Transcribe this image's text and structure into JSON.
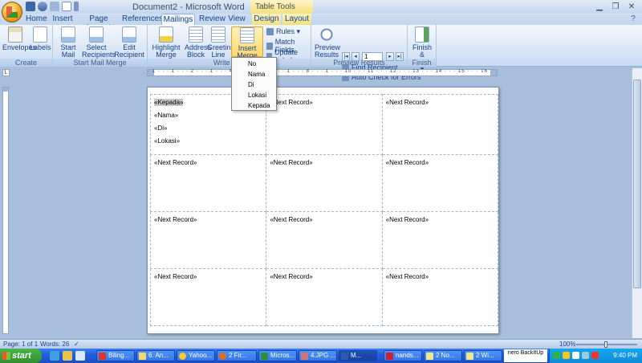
{
  "window": {
    "title": "Document2 - Microsoft Word",
    "contextual_tab": "Table Tools"
  },
  "tabs": [
    "Home",
    "Insert",
    "Page Layout",
    "References",
    "Mailings",
    "Review",
    "View",
    "Design",
    "Layout"
  ],
  "ribbon": {
    "groups": {
      "create": "Create",
      "start_mail_merge": "Start Mail Merge",
      "write_insert": "Write & In",
      "preview_results": "Preview Results",
      "finish": "Finish"
    },
    "buttons": {
      "envelopes": "Envelopes",
      "labels": "Labels",
      "start_mail_merge": "Start Mail Merge ▾",
      "select_recipients": "Select Recipients ▾",
      "edit_recipient_list": "Edit Recipient List",
      "highlight_merge_fields": "Highlight Merge Fields",
      "address_block": "Address Block",
      "greeting_line": "Greeting Line",
      "insert_merge_field": "Insert Merge Field ▾",
      "rules": "Rules ▾",
      "match_fields": "Match Fields",
      "update_labels": "Update Labels",
      "preview_results": "Preview Results",
      "find_recipient": "Find Recipient",
      "auto_check": "Auto Check for Errors",
      "finish_merge": "Finish & Merge ▾"
    },
    "record_number": "1"
  },
  "merge_field_menu": [
    "No",
    "Nama",
    "Di",
    "Lokasi",
    "Kepada"
  ],
  "ruler": {
    "ticks": "· 1 · · · 1 · · · 2 · · · 1 · · · 4 · · · 1 · · · 6 · · · 1 · · · 8 · · · 1 · · · 10 · · · 11 · · · 12 · · · 13 · · · 14 · · · 15 · · · 16 · · · 17 · · · 18 ·",
    "tab_selector": "L"
  },
  "document": {
    "first_label": [
      "«Kepada»",
      "«Nama»",
      "«Di»",
      "«Lokasi»"
    ],
    "next_record": "«Next Record»"
  },
  "status": {
    "page": "Page: 1 of 1",
    "words": "Words: 26",
    "zoom": "100%"
  },
  "taskbar": {
    "start": "start",
    "items": [
      "Biling...",
      "6. An...",
      "Yahoo...",
      "2 Fir...",
      "Micros...",
      "4.JPG ...",
      "M...",
      "nands...",
      "2 No...",
      "2 Wi..."
    ],
    "nero": "nero BackItUp",
    "clock": "9:40 PM"
  }
}
